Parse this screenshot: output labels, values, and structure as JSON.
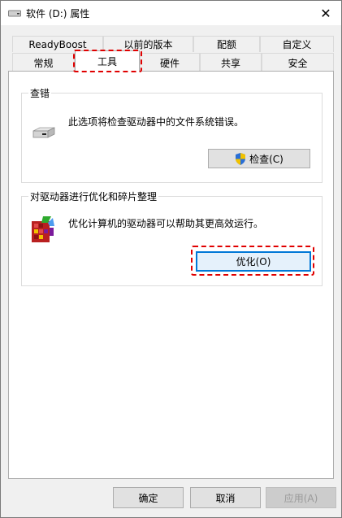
{
  "window": {
    "title": "软件 (D:) 属性",
    "close_icon": "close-icon"
  },
  "tabs_row1": [
    "ReadyBoost",
    "以前的版本",
    "配额",
    "自定义"
  ],
  "tabs_row2": [
    "常规",
    "工具",
    "硬件",
    "共享",
    "安全"
  ],
  "selected_tab": "工具",
  "check_group": {
    "title": "查错",
    "description": "此选项将检查驱动器中的文件系统错误。",
    "button_label": "检查(C)"
  },
  "optimize_group": {
    "title": "对驱动器进行优化和碎片整理",
    "description": "优化计算机的驱动器可以帮助其更高效运行。",
    "button_label": "优化(O)"
  },
  "footer": {
    "ok": "确定",
    "cancel": "取消",
    "apply": "应用(A)"
  },
  "colors": {
    "highlight": "#e00000",
    "focus_border": "#0078d7"
  }
}
